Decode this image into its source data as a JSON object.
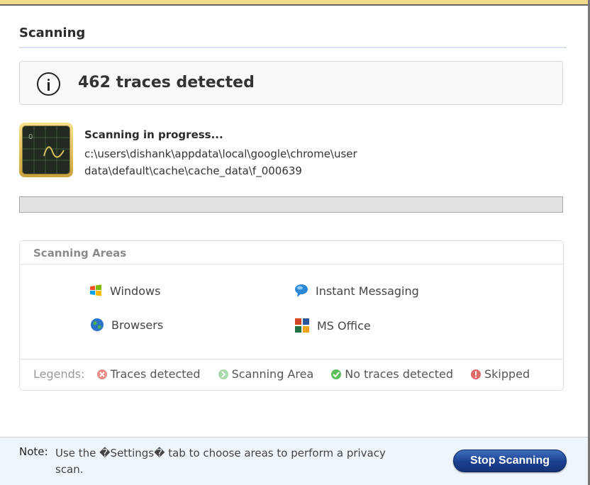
{
  "header": {
    "title": "Scanning"
  },
  "traces": {
    "text": "462 traces detected"
  },
  "scan": {
    "status": "Scanning in progress...",
    "path": "c:\\users\\dishank\\appdata\\local\\google\\chrome\\user data\\default\\cache\\cache_data\\f_000639",
    "progress": 0
  },
  "areas": {
    "title": "Scanning Areas",
    "items": [
      {
        "label": "Windows",
        "icon": "windows-icon"
      },
      {
        "label": "Instant Messaging",
        "icon": "chat-bubble-icon"
      },
      {
        "label": "Browsers",
        "icon": "globe-icon"
      },
      {
        "label": "MS Office",
        "icon": "ms-office-icon"
      }
    ]
  },
  "legends": {
    "label": "Legends:",
    "items": [
      {
        "label": "Traces detected",
        "icon": "traces-detected-icon",
        "color": "#e88a86"
      },
      {
        "label": "Scanning Area",
        "icon": "scanning-area-icon",
        "color": "#a8d9a8"
      },
      {
        "label": "No traces detected",
        "icon": "no-traces-icon",
        "color": "#5cbf5c"
      },
      {
        "label": "Skipped",
        "icon": "skipped-icon",
        "color": "#e06a6a"
      }
    ]
  },
  "footer": {
    "note_label": "Note:",
    "note_text": "Use the �Settings� tab to choose areas to perform a privacy scan.",
    "stop_label": "Stop Scanning"
  }
}
